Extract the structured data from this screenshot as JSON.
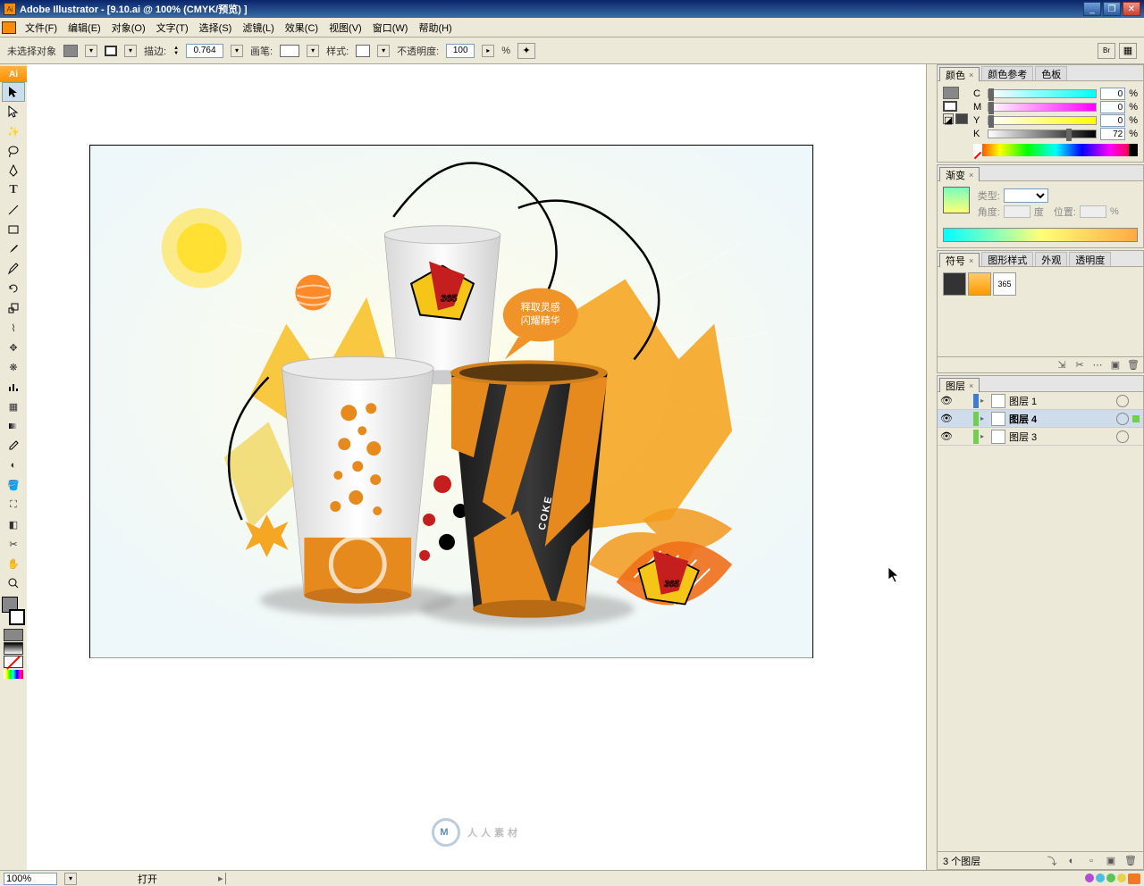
{
  "title": "Adobe Illustrator - [9.10.ai @ 100% (CMYK/预览) ]",
  "menu": [
    "文件(F)",
    "编辑(E)",
    "对象(O)",
    "文字(T)",
    "选择(S)",
    "滤镜(L)",
    "效果(C)",
    "视图(V)",
    "窗口(W)",
    "帮助(H)"
  ],
  "options": {
    "selection": "未选择对象",
    "stroke_label": "描边:",
    "stroke_weight": "0.764",
    "brush_label": "画笔:",
    "style_label": "样式:",
    "opacity_label": "不透明度:",
    "opacity": "100",
    "pct": "%"
  },
  "panels": {
    "color": {
      "tabs": [
        "颜色",
        "颜色参考",
        "色板"
      ],
      "channels": [
        {
          "ch": "C",
          "val": "0"
        },
        {
          "ch": "M",
          "val": "0"
        },
        {
          "ch": "Y",
          "val": "0"
        },
        {
          "ch": "K",
          "val": "72"
        }
      ],
      "pct": "%"
    },
    "gradient": {
      "tabs": [
        "渐变"
      ],
      "type_label": "类型:",
      "angle_label": "角度:",
      "deg": "度",
      "pos_label": "位置:",
      "pct": "%"
    },
    "symbols": {
      "tabs": [
        "符号",
        "图形样式",
        "外观",
        "透明度"
      ]
    },
    "layers": {
      "tabs": [
        "图层"
      ],
      "items": [
        {
          "name": "图层 1",
          "color": "#3b7ed0",
          "selected": false
        },
        {
          "name": "图层 4",
          "color": "#6fd04b",
          "selected": true
        },
        {
          "name": "图层 3",
          "color": "#6fd04b",
          "selected": false
        }
      ],
      "count": "3 个图层"
    }
  },
  "statusbar": {
    "zoom": "100%",
    "tool": "打开"
  },
  "artwork": {
    "bubble_line1": "释取灵感",
    "bubble_line2": "闪耀精华",
    "coke": "COKE",
    "logo365": "365"
  },
  "watermark": "人人素材"
}
